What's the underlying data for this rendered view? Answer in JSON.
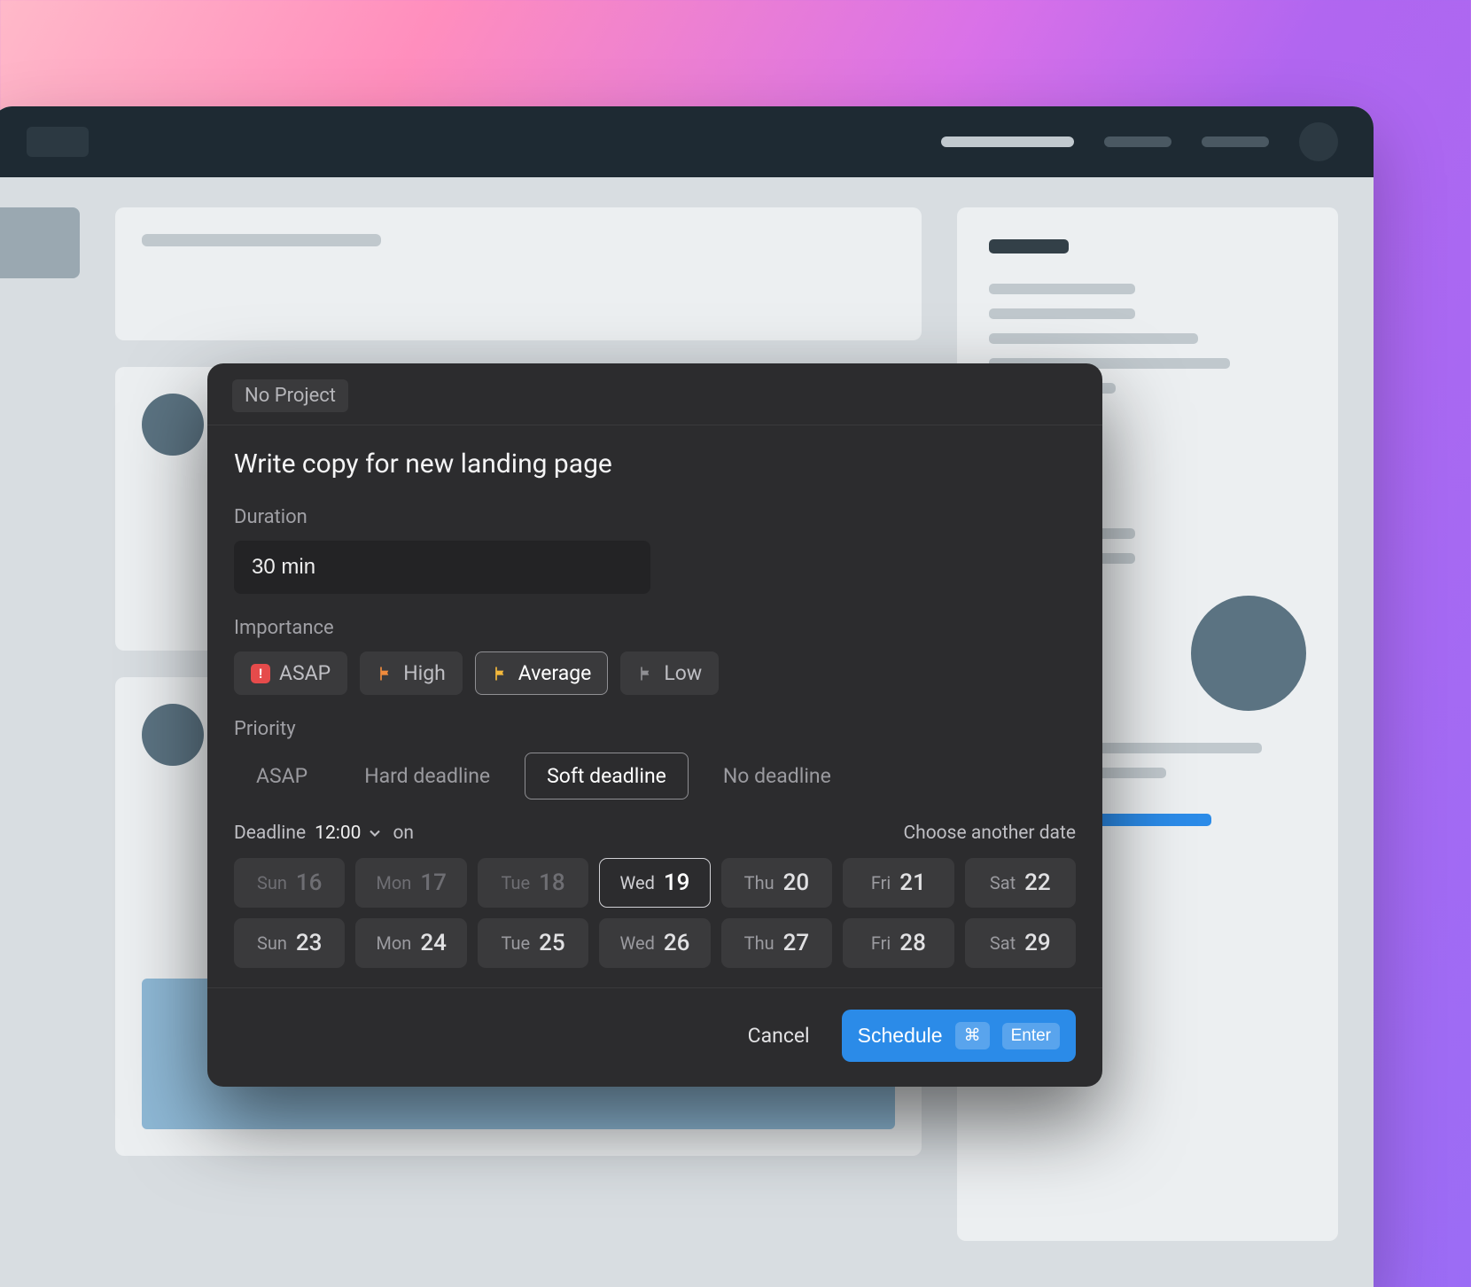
{
  "modal": {
    "project_chip": "No Project",
    "title": "Write copy for new landing page",
    "duration": {
      "label": "Duration",
      "value": "30 min"
    },
    "importance": {
      "label": "Importance",
      "options": [
        {
          "key": "asap",
          "label": "ASAP",
          "icon": "asap-badge",
          "color": "#e64b4b"
        },
        {
          "key": "high",
          "label": "High",
          "icon": "flag",
          "color": "#f08b3c"
        },
        {
          "key": "average",
          "label": "Average",
          "icon": "flag",
          "color": "#f4b93c",
          "selected": true
        },
        {
          "key": "low",
          "label": "Low",
          "icon": "flag",
          "color": "#8f8f93"
        }
      ]
    },
    "priority": {
      "label": "Priority",
      "options": [
        {
          "key": "asap",
          "label": "ASAP"
        },
        {
          "key": "hard",
          "label": "Hard deadline"
        },
        {
          "key": "soft",
          "label": "Soft deadline",
          "selected": true
        },
        {
          "key": "none",
          "label": "No deadline"
        }
      ]
    },
    "deadline": {
      "label": "Deadline",
      "time": "12:00",
      "on_label": "on",
      "choose_label": "Choose another date",
      "days": [
        {
          "dow": "Sun",
          "num": "16",
          "past": true
        },
        {
          "dow": "Mon",
          "num": "17",
          "past": true
        },
        {
          "dow": "Tue",
          "num": "18",
          "past": true
        },
        {
          "dow": "Wed",
          "num": "19",
          "selected": true
        },
        {
          "dow": "Thu",
          "num": "20"
        },
        {
          "dow": "Fri",
          "num": "21"
        },
        {
          "dow": "Sat",
          "num": "22"
        },
        {
          "dow": "Sun",
          "num": "23"
        },
        {
          "dow": "Mon",
          "num": "24"
        },
        {
          "dow": "Tue",
          "num": "25"
        },
        {
          "dow": "Wed",
          "num": "26"
        },
        {
          "dow": "Thu",
          "num": "27"
        },
        {
          "dow": "Fri",
          "num": "28"
        },
        {
          "dow": "Sat",
          "num": "29"
        }
      ]
    },
    "footer": {
      "cancel": "Cancel",
      "schedule": "Schedule",
      "kbd_cmd": "⌘",
      "kbd_enter": "Enter"
    }
  }
}
